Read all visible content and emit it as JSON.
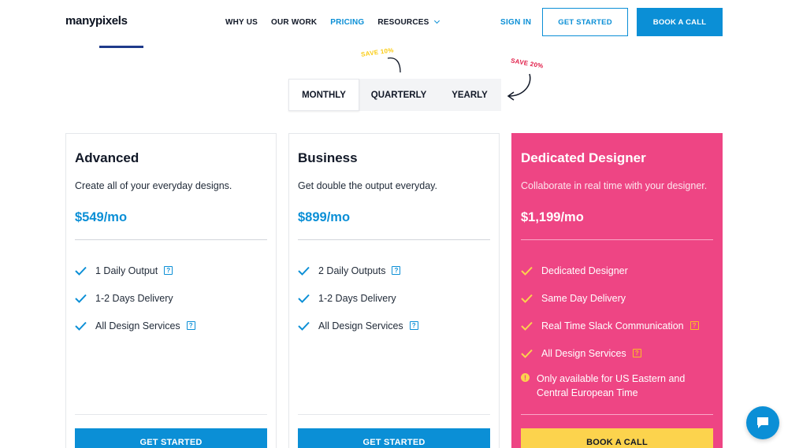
{
  "brand": {
    "logo": "manypixels",
    "accent": "#0b8fd6",
    "pink": "#ee4584",
    "yellow": "#fcd34d"
  },
  "nav": {
    "items": [
      "WHY US",
      "OUR WORK",
      "PRICING",
      "RESOURCES"
    ],
    "active": "PRICING"
  },
  "header": {
    "sign_in": "SIGN IN",
    "get_started": "GET STARTED",
    "book_call": "BOOK A CALL"
  },
  "billing": {
    "options": [
      "MONTHLY",
      "QUARTERLY",
      "YEARLY"
    ],
    "selected": "MONTHLY",
    "save_quarterly": "SAVE 10%",
    "save_yearly": "SAVE 20%"
  },
  "plans": [
    {
      "name": "Advanced",
      "description": "Create all of your everyday designs.",
      "price": "$549/mo",
      "features": [
        "1 Daily Output",
        "1-2 Days Delivery",
        "All Design Services"
      ],
      "cta": "GET STARTED"
    },
    {
      "name": "Business",
      "description": "Get double the output everyday.",
      "price": "$899/mo",
      "features": [
        "2 Daily Outputs",
        "1-2 Days Delivery",
        "All Design Services"
      ],
      "cta": "GET STARTED"
    },
    {
      "name": "Dedicated Designer",
      "description": "Collaborate in real time with your designer.",
      "price": "$1,199/mo",
      "features": [
        "Dedicated Designer",
        "Same Day Delivery",
        "Real Time Slack Communication",
        "All Design Services"
      ],
      "notice": "Only available for US Eastern and Central European Time",
      "cta": "BOOK A CALL"
    }
  ],
  "icons": {
    "help": "?",
    "warning": "!",
    "check": "check-icon",
    "chat": "chat-bubble-icon"
  }
}
